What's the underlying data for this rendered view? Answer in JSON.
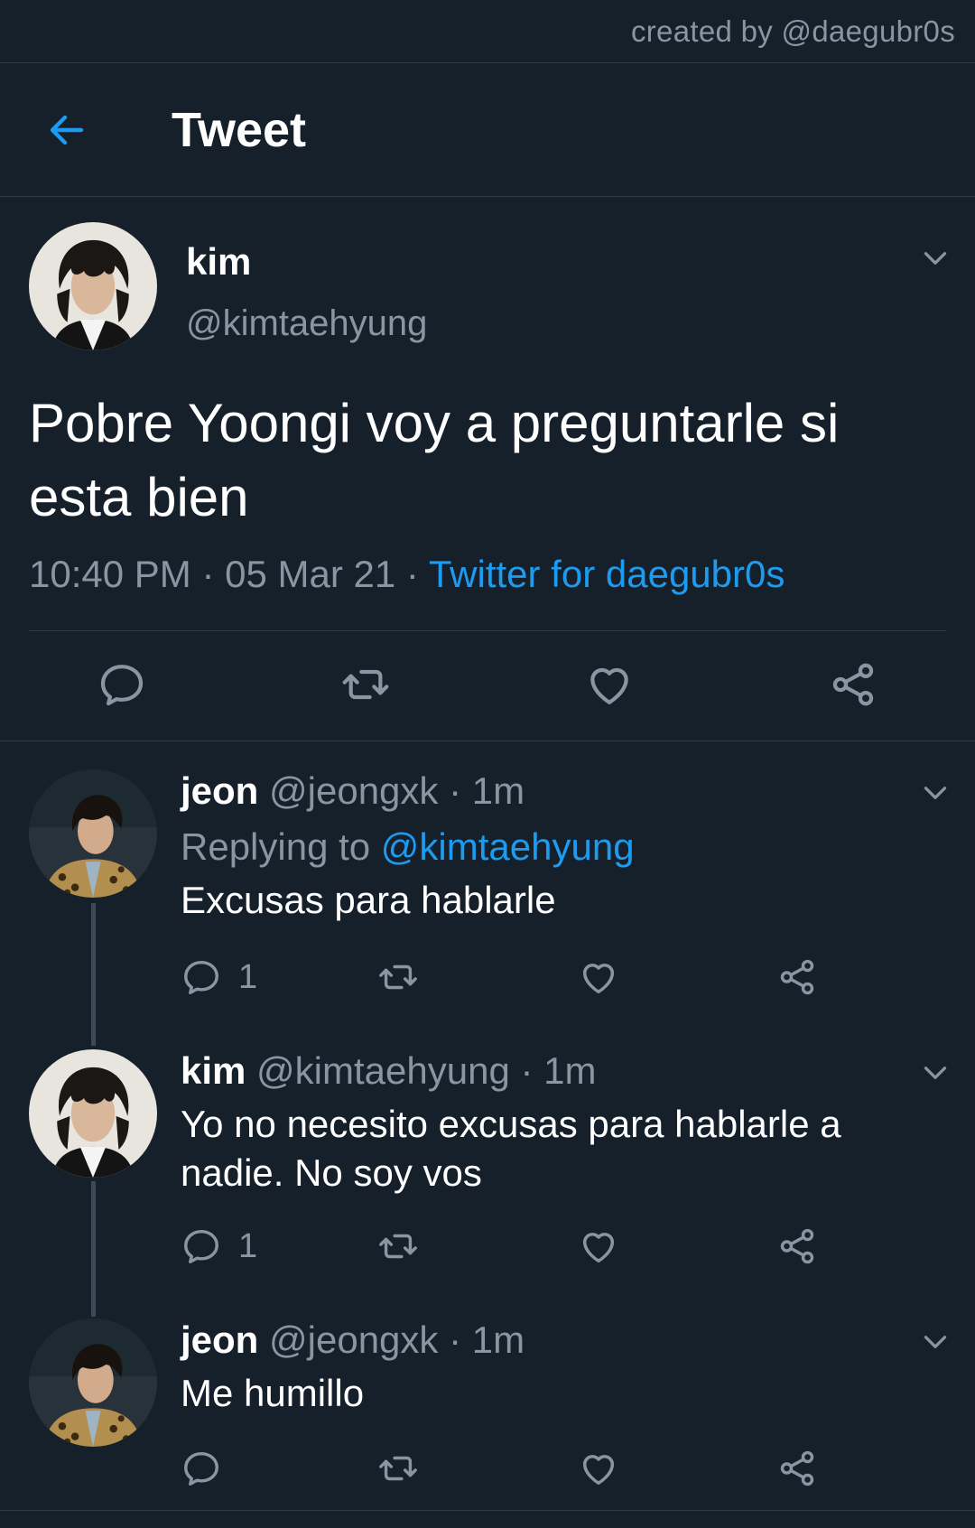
{
  "watermark": "created by @daegubr0s",
  "header": {
    "title": "Tweet"
  },
  "main_tweet": {
    "name": "kim",
    "handle": "@kimtaehyung",
    "text": "Pobre Yoongi voy a preguntarle si esta bien",
    "time": "10:40 PM",
    "date": "05 Mar 21",
    "source": "Twitter for daegubr0s"
  },
  "replies": [
    {
      "name": "jeon",
      "handle": "@jeongxk",
      "time": "1m",
      "replying_prefix": "Replying to",
      "replying_to": "@kimtaehyung",
      "text": "Excusas para hablarle",
      "reply_count": "1"
    },
    {
      "name": "kim",
      "handle": "@kimtaehyung",
      "time": "1m",
      "text": "Yo no necesito excusas para hablarle a nadie. No soy vos",
      "reply_count": "1"
    },
    {
      "name": "jeon",
      "handle": "@jeongxk",
      "time": "1m",
      "text": "Me humillo",
      "reply_count": ""
    }
  ],
  "separator": "·",
  "colors": {
    "background": "#15202b",
    "accent": "#1d9bf0",
    "muted": "#8a95a1",
    "divider": "#2f3b47"
  },
  "icons": [
    "back-arrow-icon",
    "chevron-down-icon",
    "reply-icon",
    "retweet-icon",
    "like-icon",
    "share-icon"
  ]
}
